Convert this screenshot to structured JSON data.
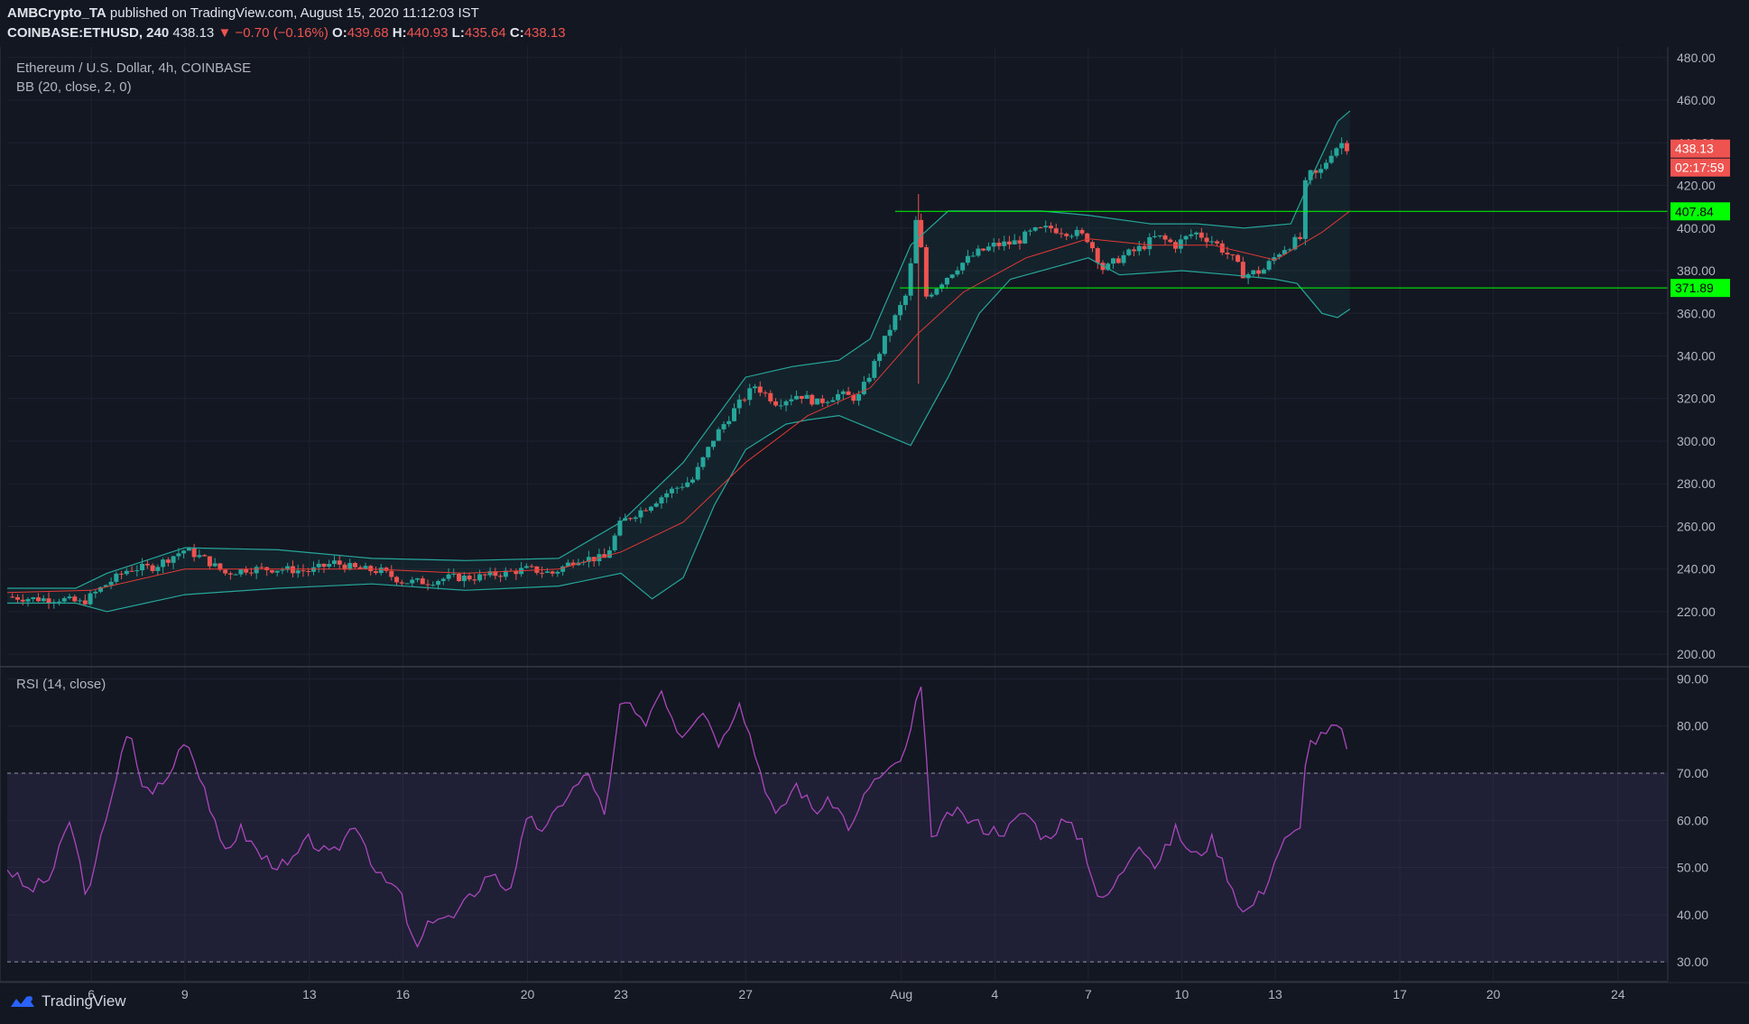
{
  "header": {
    "publisher": "AMBCrypto_TA",
    "published_text": "published on TradingView.com, August 15, 2020 11:12:03 IST",
    "symbol": "COINBASE:ETHUSD, 240",
    "last": "438.13",
    "change": "▼ −0.70 (−0.16%)",
    "o_label": "O:",
    "o_value": "439.68",
    "h_label": "H:",
    "h_value": "440.93",
    "l_label": "L:",
    "l_value": "435.64",
    "c_label": "C:",
    "c_value": "438.13"
  },
  "legend": {
    "pair": "Ethereum / U.S. Dollar, 4h, COINBASE",
    "indicator": "BB (20, close, 2, 0)",
    "rsi": "RSI (14, close)"
  },
  "brand": {
    "name": "TradingView"
  },
  "colors": {
    "background": "#131722",
    "up": "#26a69a",
    "down": "#ef5350",
    "bb_band": "#26a69a",
    "bb_basis": "#e53935",
    "level": "#00ff00",
    "rsi": "#ab47bc",
    "rsi_fill": "#7e57c2"
  },
  "chart_data": [
    {
      "type": "candlestick",
      "title": "Ethereum / U.S. Dollar, 4h, COINBASE",
      "ylim": [
        195,
        485
      ],
      "y_ticks": [
        "200.00",
        "220.00",
        "240.00",
        "260.00",
        "280.00",
        "300.00",
        "320.00",
        "340.00",
        "360.00",
        "380.00",
        "400.00",
        "420.00",
        "440.00",
        "460.00",
        "480.00"
      ],
      "x_ticks": [
        "6",
        "9",
        "13",
        "16",
        "20",
        "23",
        "27",
        "Aug",
        "4",
        "7",
        "10",
        "13",
        "17",
        "20",
        "24"
      ],
      "x_tick_days": [
        6,
        9,
        13,
        16,
        20,
        23,
        27,
        32,
        35,
        38,
        41,
        44,
        48,
        51,
        55
      ],
      "x_range_days": [
        3.3,
        56.6
      ],
      "price_levels": [
        {
          "value": 407.84,
          "label": "407.84",
          "from_day": 31.8
        },
        {
          "value": 371.89,
          "label": "371.89",
          "from_day": 31.95
        }
      ],
      "last_price": {
        "value": 438.13,
        "label": "438.13",
        "countdown": "02:17:59"
      },
      "price_path": [
        [
          3.3,
          227
        ],
        [
          4.2,
          226
        ],
        [
          5.0,
          226
        ],
        [
          5.7,
          224
        ],
        [
          6.4,
          232
        ],
        [
          7.2,
          240
        ],
        [
          8.0,
          241
        ],
        [
          8.6,
          246
        ],
        [
          9.0,
          249
        ],
        [
          9.6,
          245
        ],
        [
          10.3,
          238
        ],
        [
          11.0,
          240
        ],
        [
          12.0,
          240
        ],
        [
          13.0,
          239
        ],
        [
          13.8,
          243
        ],
        [
          14.5,
          240
        ],
        [
          15.3,
          239
        ],
        [
          16.0,
          234
        ],
        [
          16.8,
          234
        ],
        [
          17.5,
          236
        ],
        [
          18.3,
          236
        ],
        [
          19.2,
          238
        ],
        [
          20.0,
          240
        ],
        [
          20.8,
          238
        ],
        [
          21.6,
          245
        ],
        [
          22.5,
          245
        ],
        [
          23.0,
          262
        ],
        [
          23.7,
          268
        ],
        [
          24.5,
          276
        ],
        [
          25.3,
          282
        ],
        [
          26.0,
          302
        ],
        [
          26.7,
          316
        ],
        [
          27.3,
          326
        ],
        [
          28.0,
          318
        ],
        [
          28.7,
          322
        ],
        [
          29.3,
          318
        ],
        [
          30.0,
          322
        ],
        [
          30.6,
          320
        ],
        [
          31.0,
          332
        ],
        [
          31.6,
          352
        ],
        [
          32.2,
          370
        ],
        [
          32.5,
          407
        ],
        [
          32.8,
          368
        ],
        [
          33.3,
          375
        ],
        [
          33.8,
          382
        ],
        [
          34.4,
          388
        ],
        [
          35.0,
          392
        ],
        [
          35.6,
          393
        ],
        [
          36.2,
          398
        ],
        [
          36.8,
          400
        ],
        [
          37.5,
          398
        ],
        [
          38.0,
          395
        ],
        [
          38.5,
          380
        ],
        [
          39.0,
          386
        ],
        [
          39.6,
          390
        ],
        [
          40.2,
          396
        ],
        [
          40.8,
          392
        ],
        [
          41.4,
          398
        ],
        [
          42.0,
          394
        ],
        [
          42.6,
          386
        ],
        [
          43.0,
          378
        ],
        [
          43.6,
          380
        ],
        [
          44.2,
          390
        ],
        [
          44.8,
          395
        ],
        [
          45.0,
          425
        ],
        [
          45.4,
          425
        ],
        [
          45.8,
          436
        ],
        [
          46.1,
          440
        ],
        [
          46.4,
          438
        ]
      ],
      "bb_basis_path": [
        [
          3.3,
          229
        ],
        [
          6,
          230
        ],
        [
          9,
          240
        ],
        [
          12,
          240
        ],
        [
          15,
          240
        ],
        [
          18,
          238
        ],
        [
          21,
          240
        ],
        [
          23,
          248
        ],
        [
          25,
          262
        ],
        [
          27,
          290
        ],
        [
          29,
          312
        ],
        [
          31,
          325
        ],
        [
          32.5,
          350
        ],
        [
          34,
          370
        ],
        [
          36,
          386
        ],
        [
          38,
          395
        ],
        [
          40,
          392
        ],
        [
          42,
          392
        ],
        [
          44,
          385
        ],
        [
          45.5,
          398
        ],
        [
          46.4,
          408
        ]
      ],
      "bb_upper_path": [
        [
          3.3,
          231
        ],
        [
          5.5,
          231
        ],
        [
          6.5,
          238
        ],
        [
          9,
          250
        ],
        [
          12,
          249
        ],
        [
          15,
          245
        ],
        [
          18,
          244
        ],
        [
          21,
          245
        ],
        [
          23,
          262
        ],
        [
          25,
          290
        ],
        [
          27,
          330
        ],
        [
          28.5,
          335
        ],
        [
          30,
          338
        ],
        [
          31,
          348
        ],
        [
          32.3,
          392
        ],
        [
          33.5,
          408
        ],
        [
          35,
          408
        ],
        [
          36.5,
          408
        ],
        [
          38,
          406
        ],
        [
          40,
          402
        ],
        [
          41.5,
          402
        ],
        [
          43,
          400
        ],
        [
          44.5,
          402
        ],
        [
          45.2,
          425
        ],
        [
          46,
          450
        ],
        [
          46.4,
          455
        ]
      ],
      "bb_lower_path": [
        [
          3.3,
          224
        ],
        [
          5.5,
          224
        ],
        [
          6.5,
          220
        ],
        [
          9,
          228
        ],
        [
          12,
          231
        ],
        [
          15,
          233
        ],
        [
          18,
          230
        ],
        [
          21,
          232
        ],
        [
          23,
          238
        ],
        [
          24,
          226
        ],
        [
          25,
          236
        ],
        [
          26,
          270
        ],
        [
          27,
          296
        ],
        [
          28.3,
          308
        ],
        [
          29,
          310
        ],
        [
          30,
          312
        ],
        [
          31,
          306
        ],
        [
          32.3,
          298
        ],
        [
          33.5,
          330
        ],
        [
          34.5,
          360
        ],
        [
          35.5,
          376
        ],
        [
          37,
          382
        ],
        [
          38,
          386
        ],
        [
          39,
          378
        ],
        [
          41,
          380
        ],
        [
          42.6,
          378
        ],
        [
          44,
          376
        ],
        [
          44.7,
          374
        ],
        [
          45.5,
          360
        ],
        [
          46,
          358
        ],
        [
          46.4,
          362
        ]
      ]
    },
    {
      "type": "line",
      "title": "RSI (14, close)",
      "ylim": [
        26,
        92
      ],
      "y_ticks": [
        "30.00",
        "40.00",
        "50.00",
        "60.00",
        "70.00",
        "80.00",
        "90.00"
      ],
      "bands": [
        30,
        70
      ],
      "rsi_path": [
        [
          3.3,
          50
        ],
        [
          4.0,
          45
        ],
        [
          4.7,
          48
        ],
        [
          5.3,
          60
        ],
        [
          5.9,
          43
        ],
        [
          6.5,
          62
        ],
        [
          7.2,
          79
        ],
        [
          7.7,
          66
        ],
        [
          8.4,
          68
        ],
        [
          9.0,
          78
        ],
        [
          9.6,
          68
        ],
        [
          10.2,
          53
        ],
        [
          10.8,
          58
        ],
        [
          11.5,
          52
        ],
        [
          12.3,
          50
        ],
        [
          13.0,
          56
        ],
        [
          13.7,
          52
        ],
        [
          14.5,
          60
        ],
        [
          15.2,
          48
        ],
        [
          15.9,
          45
        ],
        [
          16.4,
          32
        ],
        [
          17.0,
          40
        ],
        [
          17.6,
          39
        ],
        [
          18.2,
          44
        ],
        [
          18.8,
          49
        ],
        [
          19.4,
          45
        ],
        [
          20.0,
          60
        ],
        [
          20.6,
          58
        ],
        [
          21.2,
          65
        ],
        [
          22.0,
          70
        ],
        [
          22.5,
          60
        ],
        [
          23.0,
          86
        ],
        [
          23.7,
          80
        ],
        [
          24.3,
          88
        ],
        [
          24.9,
          78
        ],
        [
          25.6,
          84
        ],
        [
          26.2,
          76
        ],
        [
          26.8,
          86
        ],
        [
          27.4,
          72
        ],
        [
          28.0,
          60
        ],
        [
          28.6,
          68
        ],
        [
          29.2,
          62
        ],
        [
          29.8,
          64
        ],
        [
          30.4,
          58
        ],
        [
          31.0,
          68
        ],
        [
          31.6,
          70
        ],
        [
          32.2,
          75
        ],
        [
          32.6,
          90
        ],
        [
          33.0,
          55
        ],
        [
          33.6,
          62
        ],
        [
          34.2,
          60
        ],
        [
          34.8,
          58
        ],
        [
          35.4,
          58
        ],
        [
          36.0,
          62
        ],
        [
          36.6,
          56
        ],
        [
          37.2,
          60
        ],
        [
          37.8,
          56
        ],
        [
          38.4,
          42
        ],
        [
          39.0,
          48
        ],
        [
          39.6,
          56
        ],
        [
          40.2,
          50
        ],
        [
          40.8,
          58
        ],
        [
          41.4,
          52
        ],
        [
          42.0,
          56
        ],
        [
          42.5,
          48
        ],
        [
          43.0,
          40
        ],
        [
          43.6,
          45
        ],
        [
          44.2,
          55
        ],
        [
          44.8,
          58
        ],
        [
          45.0,
          76
        ],
        [
          45.6,
          78
        ],
        [
          46.0,
          80
        ],
        [
          46.4,
          75
        ]
      ]
    }
  ]
}
